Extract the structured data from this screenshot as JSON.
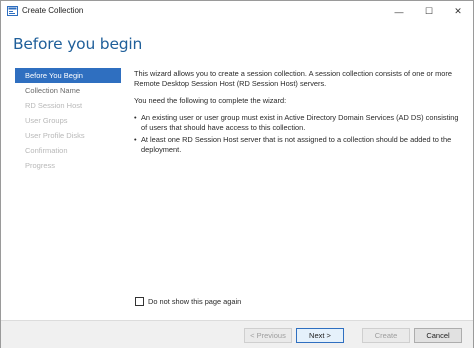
{
  "window": {
    "title": "Create Collection",
    "controls": {
      "minimize": "—",
      "maximize": "☐",
      "close": "✕"
    }
  },
  "header": {
    "title": "Before you begin"
  },
  "nav": {
    "items": [
      {
        "label": "Before You Begin",
        "state": "active"
      },
      {
        "label": "Collection Name",
        "state": "enabled"
      },
      {
        "label": "RD Session Host",
        "state": "disabled"
      },
      {
        "label": "User Groups",
        "state": "disabled"
      },
      {
        "label": "User Profile Disks",
        "state": "disabled"
      },
      {
        "label": "Confirmation",
        "state": "disabled"
      },
      {
        "label": "Progress",
        "state": "disabled"
      }
    ]
  },
  "content": {
    "intro": "This wizard allows you to create a session collection. A session collection consists of one or more Remote Desktop Session Host (RD Session Host) servers.",
    "requirements_heading": "You need the following to complete the wizard:",
    "bullets": [
      "An existing user or user group must exist in Active Directory Domain Services (AD DS) consisting of users that should have access to this collection.",
      "At least one RD Session Host server that is not assigned to a collection should be added to the deployment."
    ]
  },
  "checkbox": {
    "label": "Do not show this page again",
    "checked": false
  },
  "footer": {
    "previous": "< Previous",
    "next": "Next >",
    "create": "Create",
    "cancel": "Cancel"
  },
  "colors": {
    "accent": "#2f6fc0",
    "title": "#1f5f9a"
  }
}
